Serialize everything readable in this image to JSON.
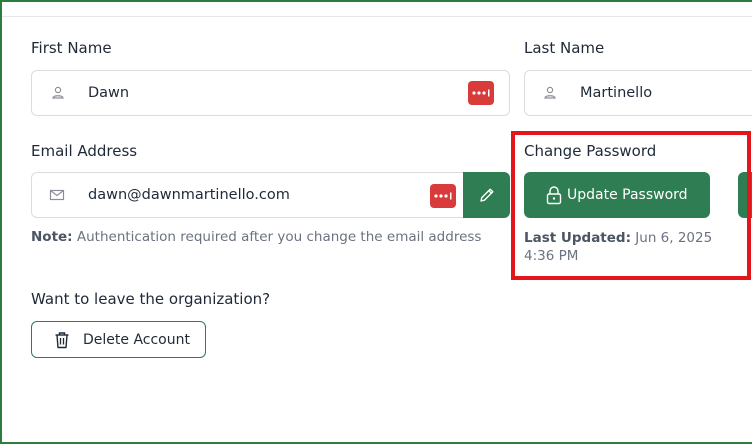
{
  "first_name": {
    "label": "First Name",
    "value": "Dawn"
  },
  "last_name": {
    "label": "Last Name",
    "value": "Martinello"
  },
  "email": {
    "label": "Email Address",
    "value": "dawn@dawnmartinello.com",
    "note_prefix": "Note:",
    "note_text": "Authentication required after you change the email address"
  },
  "password": {
    "label": "Change Password",
    "button_label": "Update Password",
    "last_updated_label": "Last Updated:",
    "last_updated_value": "Jun 6, 2025 4:36 PM"
  },
  "leave": {
    "heading": "Want to leave the organization?",
    "button_label": "Delete Account"
  },
  "icons": {
    "person": "person-icon",
    "mail": "mail-icon",
    "password_manager": "password-manager-icon",
    "pencil": "pencil-icon",
    "lock": "lock-icon",
    "trash": "trash-icon"
  },
  "colors": {
    "primary_green": "#2f7d52",
    "frame_green": "#2f7d3e",
    "highlight_red": "#e3171b",
    "pm_red": "#d93a3a"
  }
}
